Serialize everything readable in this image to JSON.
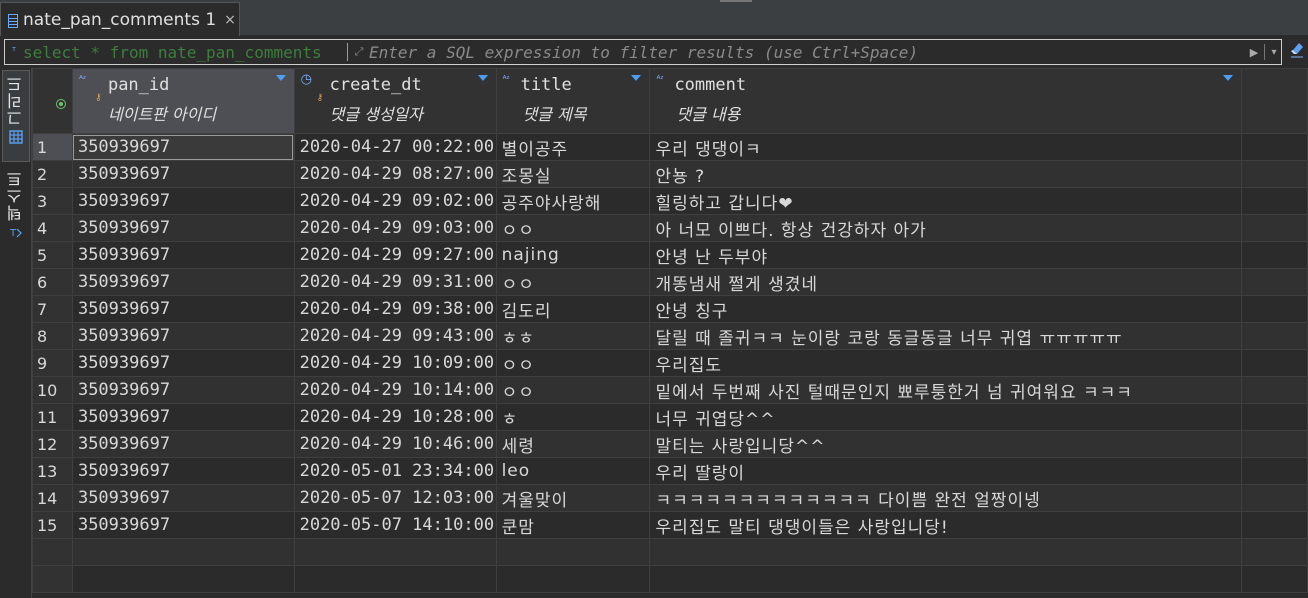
{
  "tab": {
    "label": "nate_pan_comments 1",
    "close": "×"
  },
  "filter": {
    "sql": "select * from nate_pan_comments",
    "placeholder": "Enter a SQL expression to filter results (use Ctrl+Space)"
  },
  "side_tabs": {
    "grid": "그리드",
    "text": "텍스트"
  },
  "columns": [
    {
      "name": "pan_id",
      "desc": "네이트판 아이디",
      "type_icon": "A-Z",
      "key": true
    },
    {
      "name": "create_dt",
      "desc": "댓글 생성일자",
      "type_icon": "clock-icon",
      "key": true
    },
    {
      "name": "title",
      "desc": "댓글 제목",
      "type_icon": "A-Z",
      "key": false
    },
    {
      "name": "comment",
      "desc": "댓글 내용",
      "type_icon": "A-Z",
      "key": false
    }
  ],
  "rows": [
    {
      "n": "1",
      "pan_id": "350939697",
      "create_dt": "2020-04-27 00:22:00",
      "title": "별이공주",
      "comment": "우리 댕댕이ㅋ"
    },
    {
      "n": "2",
      "pan_id": "350939697",
      "create_dt": "2020-04-29 08:27:00",
      "title": "조몽실",
      "comment": "안뇽 ?"
    },
    {
      "n": "3",
      "pan_id": "350939697",
      "create_dt": "2020-04-29 09:02:00",
      "title": "공주야사랑해",
      "comment": "힐링하고 갑니다❤"
    },
    {
      "n": "4",
      "pan_id": "350939697",
      "create_dt": "2020-04-29 09:03:00",
      "title": "ㅇㅇ",
      "comment": "아 너모 이쁘다. 항상 건강하자 아가"
    },
    {
      "n": "5",
      "pan_id": "350939697",
      "create_dt": "2020-04-29 09:27:00",
      "title": "najing",
      "comment": "안녕 난 두부야"
    },
    {
      "n": "6",
      "pan_id": "350939697",
      "create_dt": "2020-04-29 09:31:00",
      "title": "ㅇㅇ",
      "comment": "개똥냄새 쩔게 생겼네"
    },
    {
      "n": "7",
      "pan_id": "350939697",
      "create_dt": "2020-04-29 09:38:00",
      "title": "김도리",
      "comment": "안녕 칭구"
    },
    {
      "n": "8",
      "pan_id": "350939697",
      "create_dt": "2020-04-29 09:43:00",
      "title": "ㅎㅎ",
      "comment": "달릴 때 졸귀ㅋㅋ 눈이랑 코랑 동글동글 너무 귀엽 ㅠㅠㅠㅠㅠ"
    },
    {
      "n": "9",
      "pan_id": "350939697",
      "create_dt": "2020-04-29 10:09:00",
      "title": "ㅇㅇ",
      "comment": "우리집도"
    },
    {
      "n": "10",
      "pan_id": "350939697",
      "create_dt": "2020-04-29 10:14:00",
      "title": "ㅇㅇ",
      "comment": "밑에서 두번째 사진 털때문인지 뾰루퉁한거 넘 귀여워요 ㅋㅋㅋ"
    },
    {
      "n": "11",
      "pan_id": "350939697",
      "create_dt": "2020-04-29 10:28:00",
      "title": "ㅎ",
      "comment": "너무 귀엽당^^"
    },
    {
      "n": "12",
      "pan_id": "350939697",
      "create_dt": "2020-04-29 10:46:00",
      "title": "세령",
      "comment": "말티는 사랑입니당^^"
    },
    {
      "n": "13",
      "pan_id": "350939697",
      "create_dt": "2020-05-01 23:34:00",
      "title": "leo",
      "comment": "우리 딸랑이"
    },
    {
      "n": "14",
      "pan_id": "350939697",
      "create_dt": "2020-05-07 12:03:00",
      "title": "겨울맞이",
      "comment": "ㅋㅋㅋㅋㅋㅋㅋㅋㅋㅋㅋㅋㅋ 다이쁨 완전 얼짱이넹"
    },
    {
      "n": "15",
      "pan_id": "350939697",
      "create_dt": "2020-05-07 14:10:00",
      "title": "쿤맘",
      "comment": "우리집도 말티 댕댕이들은 사랑입니당!"
    }
  ],
  "colors": {
    "background": "#2b2b2b",
    "sql_text": "#3b7f3b",
    "accent": "#4d9df5",
    "selected_header": "#4e4f55"
  }
}
